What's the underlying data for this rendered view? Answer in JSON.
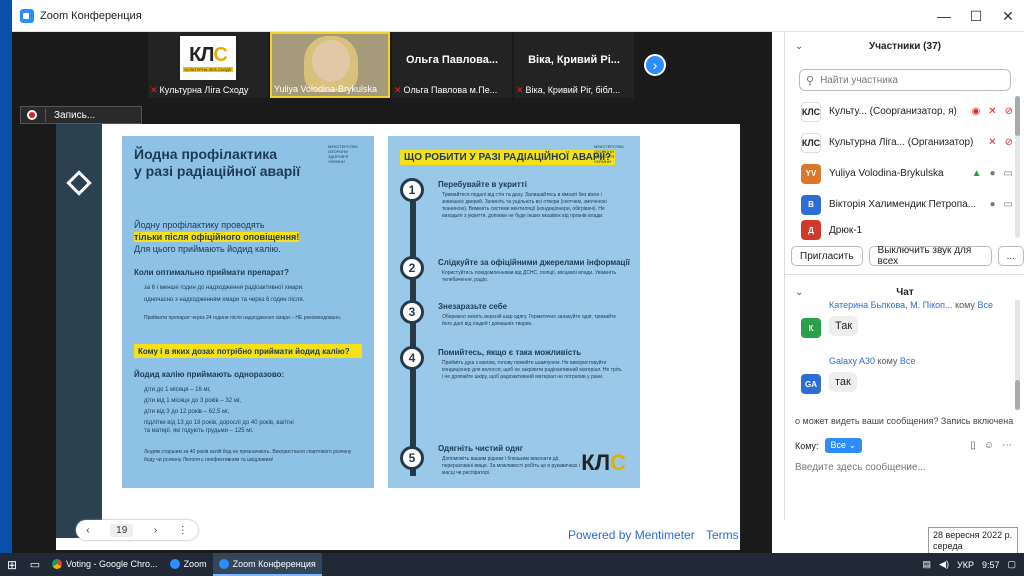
{
  "window": {
    "title": "Zoom Конференция"
  },
  "video_strip": {
    "tiles": [
      {
        "label": "Культурна Ліга Сходу",
        "logo_text": "КЛС",
        "logo_sub": "КУЛЬТУРНА ЛІГА СХОДУ"
      },
      {
        "label": "Yuliya Volodina-Brykulska"
      },
      {
        "big_name": "Ольга Павлова...",
        "label": "Ольга Павлова м.Пе..."
      },
      {
        "big_name": "Віка, Кривий Рі...",
        "label": "Віка, Кривий Ріг, бібл..."
      }
    ]
  },
  "recording": {
    "label": "Запись..."
  },
  "share_toolbar": {
    "page": "19"
  },
  "poster_left": {
    "title_line1": "Йодна профілактика",
    "title_line2": "у разі радіаційної аварії",
    "ministry": "МІНІСТЕРСТВО ОХОРОНИ ЗДОРОВ'Я УКРАЇНИ",
    "s1": "Йодну профілактику проводять",
    "s2": "тільки після офіційного оповіщення!",
    "s3": "Для цього приймають йодид калію.",
    "h1": "Коли оптимально приймати препарат?",
    "b1": "за 6 і менше годин до надходження радіоактивної хмари.",
    "b2": "одночасно з надходженням хмари та через 6 годин після.",
    "note1": "Приймати препарат через 24 години після надходження хмари – НЕ рекомендовано.",
    "hl2": "Кому і в яких дозах потрібно приймати йодид калію?",
    "h2": "Йодид калію приймають одноразово:",
    "d1": "діти до 1 місяця – 16 мг,",
    "d2": "діти від 1 місяця до 3 років – 32 мг,",
    "d3": "діти від 3 до 12 років – 62,5 мг,",
    "d4": "підлітки від 13 до 18 років, дорослі до 40 років, вагітні та матері, які годують грудьми – 125 мг.",
    "note2": "Людям старшим за 40 років калій йод не призначають. Використання спиртового розчину йоду чи розчину Люголя є неефективним та шкідливим!"
  },
  "poster_right": {
    "title": "ЩО РОБИТИ У РАЗІ РАДІАЦІЙНОЇ АВАРІЇ?",
    "ministry": "МІНІСТЕРСТВО ОХОРОНИ ЗДОРОВ'Я УКРАЇНИ",
    "steps": [
      {
        "num": "1",
        "head": "Перебувайте в укритті",
        "text": "Тримайтеся подалі від стін та даху. Залишайтесь в кімнаті без вікон і зовнішніх дверей. Зачиніть та ущільніть всі отвори (скотчем, змоченою тканиною). Вимкніть системи вентиляції (кондиціонери, обігрівачі). Не виходьте з укриття, доповки не буде інших вказівок від органів влади."
      },
      {
        "num": "2",
        "head": "Слідкуйте за офіційними джерелами інформації",
        "text": "Користуйтесь повідомленнями від ДСНС, поліції, місцевої влади. Увімкніть телебачення, радіо."
      },
      {
        "num": "3",
        "head": "Знезаразьте себе",
        "text": "Обережно зніміть верхній шар одягу. Герметично запакуйте одяг, тримайте його далі від людей і домашніх тварин."
      },
      {
        "num": "4",
        "head": "Помийтесь, якщо є така можливість",
        "text": "Прийміть душ з милом, голову помийте шампунем. Не використовуйте кондиціонер для волосся, щоб не закріпити радіоактивний матеріал. Не тріть і не дряпайте шкіру, щоб радіоактивний матеріал не потрапив у рани."
      },
      {
        "num": "5",
        "head": "Одягніть чистий одяг",
        "text": "Допоможіть вашим рідним і близьким виконати дії, перераховані вище. За можливості робіть це в рукавичках і масці чи респіраторі."
      }
    ],
    "footer_logo": "КЛС",
    "footer_sub": "КУЛЬТУРНА ЛІГА СХОДУ"
  },
  "footer_links": {
    "powered": "Powered by Mentimeter",
    "terms": "Terms"
  },
  "date_tooltip": {
    "line1": "28 вересня 2022 р.",
    "line2": "середа"
  },
  "participants": {
    "header": "Участники (37)",
    "search_placeholder": "Найти участника",
    "rows": [
      {
        "avatar": "КЛС",
        "name": "Культу... (Соорганизатор, я)"
      },
      {
        "avatar": "КЛС",
        "name": "Культурна Ліга... (Организатор)"
      },
      {
        "avatar": "YV",
        "name": "Yuliya Volodina-Brykulska"
      },
      {
        "avatar": "В",
        "name": "Вікторія Халимендик Петропа..."
      },
      {
        "avatar": "Д",
        "name": "Дрюк-1"
      }
    ],
    "invite_label": "Пригласить",
    "mute_all_label": "Выключить звук для всех",
    "more_label": "..."
  },
  "chat": {
    "header": "Чат",
    "messages": [
      {
        "sender": "Катерина Бьлкова, М. Пікоп...",
        "to_word": "кому",
        "to": "Все",
        "avatar": "К",
        "text": "Так",
        "color": "#2aa04a"
      },
      {
        "sender": "Galaxy A30",
        "to_word": "кому",
        "to": "Все",
        "avatar": "GA",
        "text": "так",
        "color": "#2d6ed6"
      }
    ],
    "notice": "о может видеть ваши сообщения? Запись включена",
    "to_label": "Кому:",
    "to_value": "Все",
    "input_placeholder": "Введите здесь сообщение..."
  },
  "taskbar": {
    "items": [
      {
        "label": "Voting - Google Chro..."
      },
      {
        "label": "Zoom"
      },
      {
        "label": "Zoom Конференция"
      }
    ],
    "lang": "УКР",
    "time": "9:57"
  }
}
